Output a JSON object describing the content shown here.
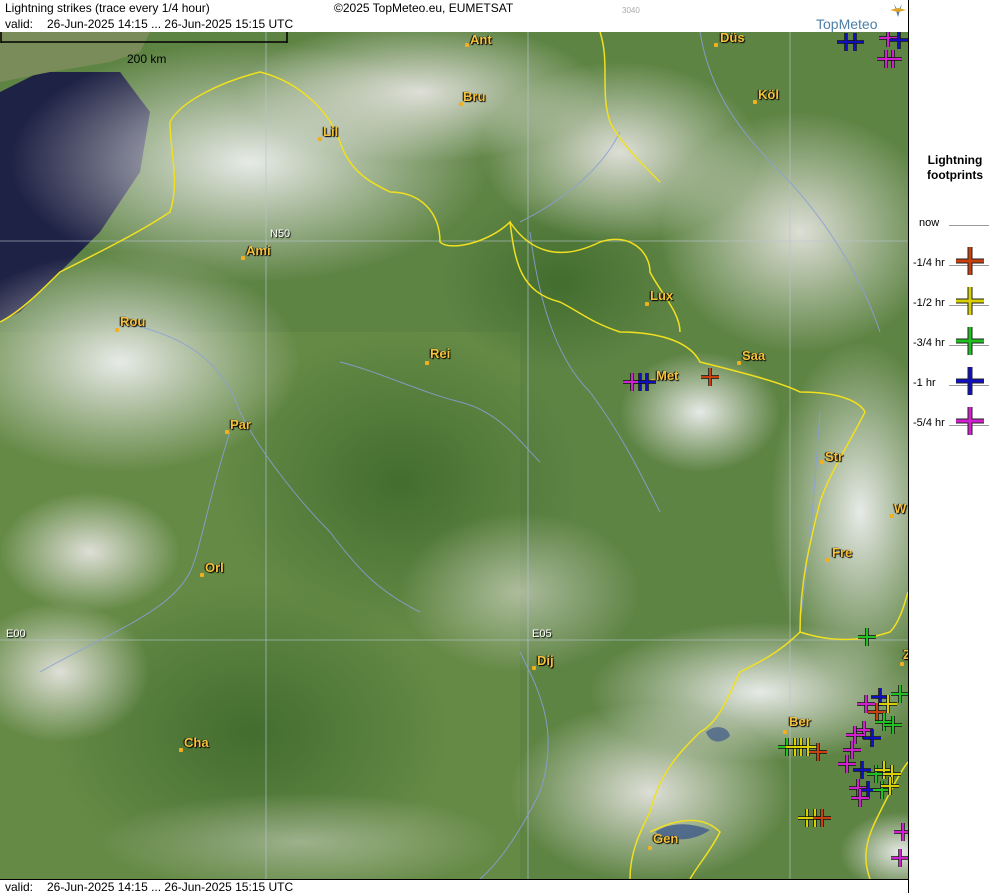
{
  "header": {
    "title": "Lightning strikes (trace every 1/4 hour)",
    "copyright": "©2025 TopMeteo.eu, EUMETSAT",
    "code": "3040",
    "valid_label": "valid:",
    "valid_range": "26-Jun-2025 14:15 ... 26-Jun-2025 15:15 UTC"
  },
  "footer": {
    "valid_label": "valid:",
    "valid_range": "26-Jun-2025 14:15 ... 26-Jun-2025 15:15 UTC"
  },
  "logo": {
    "text": "TopMeteo"
  },
  "scale": {
    "label": "200 km"
  },
  "grid": {
    "lat_label": "N50",
    "lon_labels": [
      "E00",
      "E05"
    ]
  },
  "cities": [
    "Ant",
    "Düs",
    "Bru",
    "Köl",
    "Lil",
    "Ami",
    "Rou",
    "Lux",
    "Rei",
    "Saa",
    "Met",
    "Par",
    "Str",
    "W",
    "Fre",
    "Orl",
    "Dij",
    "Ber",
    "Cha",
    "Gen",
    "Z"
  ],
  "legend": {
    "title_line1": "Lightning",
    "title_line2": "footprints",
    "items": [
      {
        "label": "now",
        "color": ""
      },
      {
        "label": "-1/4 hr",
        "color": "#c8400c"
      },
      {
        "label": "-1/2 hr",
        "color": "#d8d000"
      },
      {
        "label": "-3/4 hr",
        "color": "#20c020"
      },
      {
        "label": "-1 hr",
        "color": "#1010c0"
      },
      {
        "label": "-5/4 hr",
        "color": "#d020d0"
      }
    ]
  },
  "colors": {
    "border": "#f0e020",
    "rivers": "#8aa0d8",
    "city": "#f6c23c"
  }
}
